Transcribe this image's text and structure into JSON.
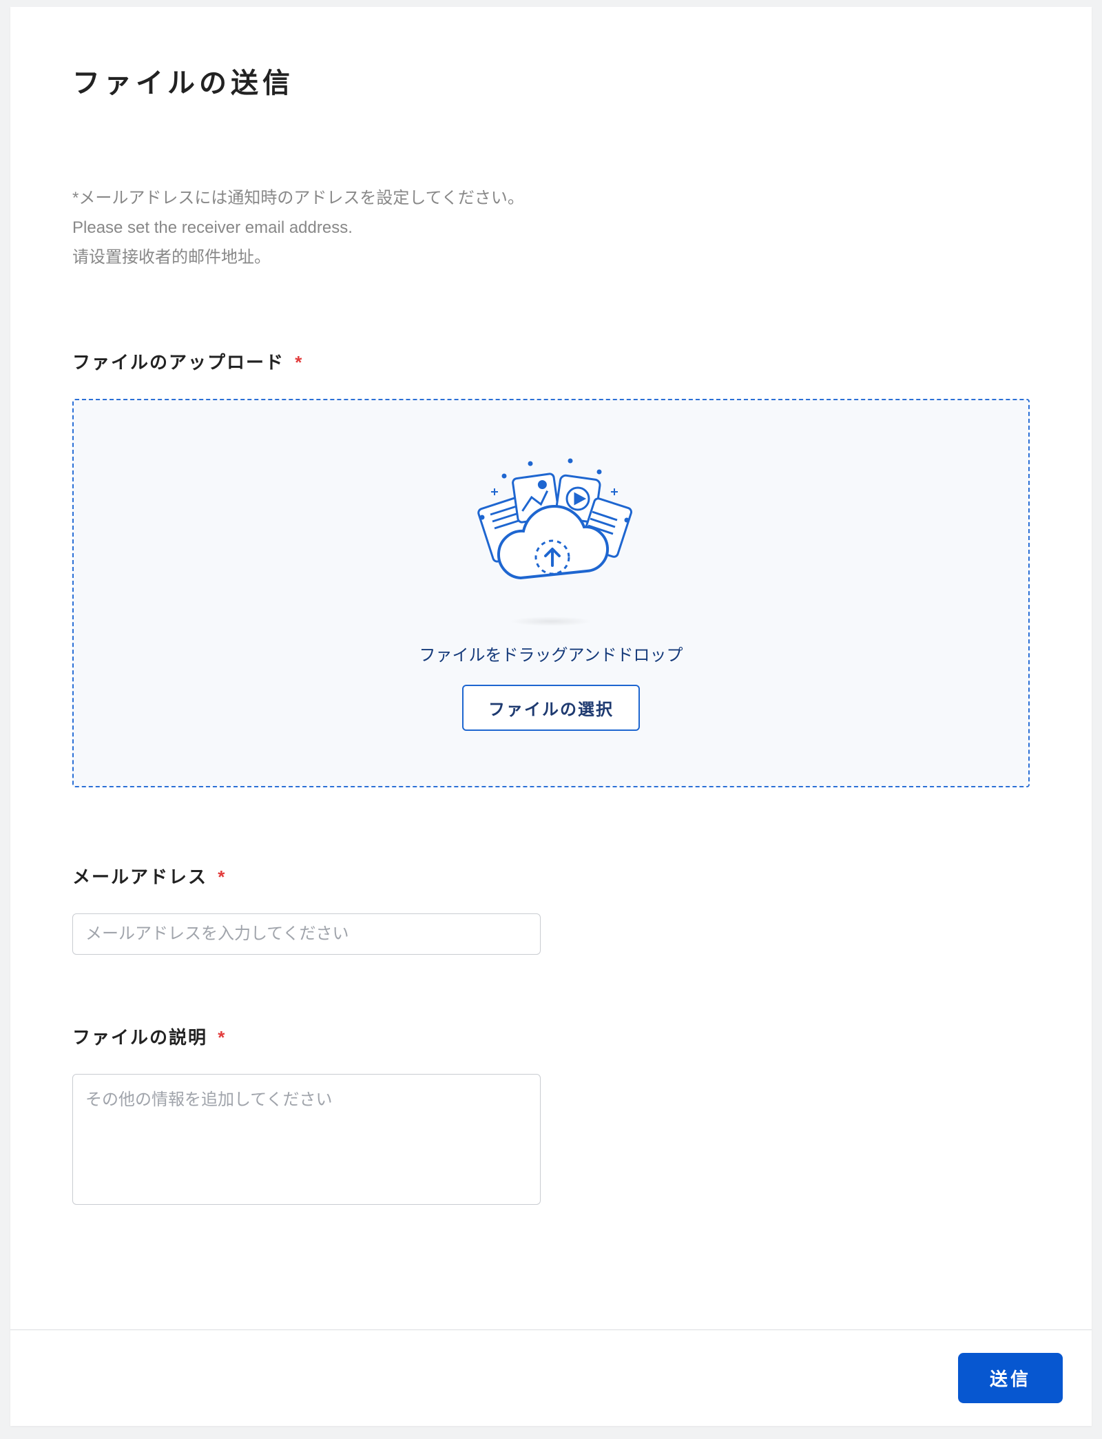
{
  "page": {
    "title": "ファイルの送信"
  },
  "note": {
    "line1": "*メールアドレスには通知時のアドレスを設定してください。",
    "line2": "Please set the receiver email address.",
    "line3": "请设置接收者的邮件地址。"
  },
  "upload": {
    "label": "ファイルのアップロード",
    "dropzone_text": "ファイルをドラッグアンドドロップ",
    "select_button": "ファイルの選択"
  },
  "email": {
    "label": "メールアドレス",
    "placeholder": "メールアドレスを入力してください",
    "value": ""
  },
  "description": {
    "label": "ファイルの説明",
    "placeholder": "その他の情報を追加してください",
    "value": ""
  },
  "footer": {
    "submit": "送信"
  },
  "required_marker": "*",
  "colors": {
    "primary": "#0757d0",
    "border_dashed": "#2a6fd6",
    "required": "#e23c3c"
  }
}
